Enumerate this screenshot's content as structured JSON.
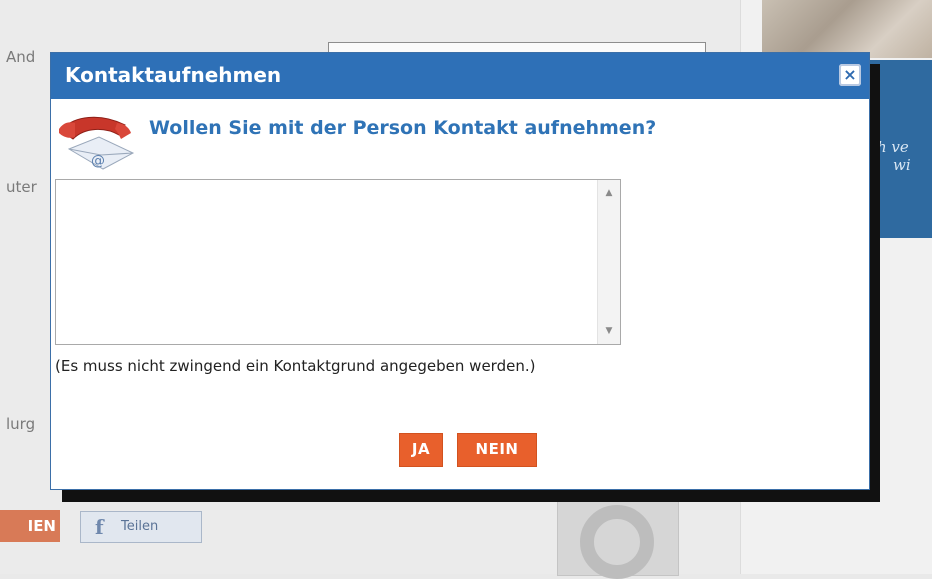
{
  "background": {
    "labels": [
      "And",
      "uter",
      "lurg"
    ],
    "promo_text": [
      "h ve",
      "wi"
    ],
    "orange_button_label": "IEN",
    "share_button": {
      "icon": "f",
      "label": "Teilen"
    }
  },
  "dialog": {
    "title": "Kontaktaufnehmen",
    "close_label": "×",
    "question": "Wollen Sie mit der Person Kontakt aufnehmen?",
    "textarea_value": "",
    "scroll_up": "▲",
    "scroll_down": "▼",
    "hint": "(Es muss nicht zwingend ein Kontaktgrund angegeben werden.)",
    "yes_label": "JA",
    "no_label": "NEIN"
  },
  "colors": {
    "title_bar": "#2e70b7",
    "question_text": "#2f73b6",
    "button_orange": "#e8602c",
    "phone_red": "#c8362a"
  },
  "icons": {
    "contact": "phone-envelope-icon",
    "close": "close-icon",
    "share": "facebook-icon"
  }
}
